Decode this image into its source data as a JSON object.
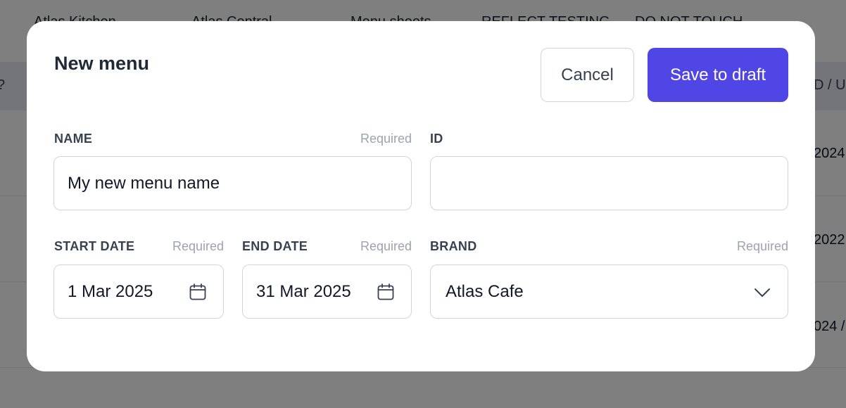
{
  "background": {
    "nav_items": [
      "Atlas Kitchen",
      "Atlas Central",
      "Menu sheets",
      "REFLECT TESTING",
      "DO NOT TOUCH"
    ],
    "table_header_left": "?",
    "table_header_right": "D / U",
    "rows": [
      {
        "right_text": "2024"
      },
      {
        "right_text": "2022"
      },
      {
        "right_text": "024 /"
      }
    ]
  },
  "modal": {
    "title": "New menu",
    "cancel_label": "Cancel",
    "save_label": "Save to draft",
    "required_text": "Required",
    "name": {
      "label": "NAME",
      "value": "My new menu name",
      "required": true
    },
    "id": {
      "label": "ID",
      "value": ""
    },
    "start_date": {
      "label": "START DATE",
      "value": "1 Mar 2025",
      "required": true,
      "icon": "calendar-icon"
    },
    "end_date": {
      "label": "END DATE",
      "value": "31 Mar 2025",
      "required": true,
      "icon": "calendar-icon"
    },
    "brand": {
      "label": "BRAND",
      "value": "Atlas Cafe",
      "required": true,
      "icon": "chevron-down-icon"
    }
  },
  "colors": {
    "primary": "#4f46e5",
    "overlay": "rgba(0,0,0,0.5)",
    "table_header_bg": "#e9e9f7"
  }
}
